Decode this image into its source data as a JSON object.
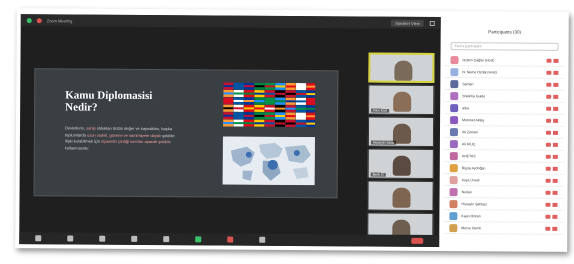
{
  "window": {
    "title": "Zoom Meeting",
    "view_button": "Speaker View"
  },
  "slide": {
    "title": "Kamu Diplomasisi Nedir?",
    "body_segments": [
      {
        "text": "Devletlerin, ",
        "hl": false
      },
      {
        "text": "sahip",
        "hl": true
      },
      {
        "text": " oldukları bütün değer ve kaynakları, başka toplumlarda ",
        "hl": false
      },
      {
        "text": "uzun vadeli, güvene ve samimiyete dayalı",
        "hl": true
      },
      {
        "text": " şekilde ilişki kurabilmek için ",
        "hl": false
      },
      {
        "text": "siyasetin çizdiği sınırları aşacak şekilde",
        "hl": true
      },
      {
        "text": " kullanmasıdır.",
        "hl": false
      }
    ]
  },
  "videos": [
    {
      "name": "",
      "active": true,
      "face": "#7a6a5a"
    },
    {
      "name": "Fikri Kurt",
      "active": false,
      "face": "#8a6e58"
    },
    {
      "name": "Hüseyin Sara",
      "active": false,
      "face": "#6b5a4c"
    },
    {
      "name": "Berk Ö",
      "active": false,
      "face": "#5a4a40"
    },
    {
      "name": "",
      "active": false,
      "face": "#7d6552"
    },
    {
      "name": "",
      "active": false,
      "face": "#6e5e50"
    }
  ],
  "participants_panel": {
    "title": "Participants (30)",
    "search_placeholder": "Find a participant",
    "items": [
      {
        "name": "Ozlem Çağlar (Host)",
        "color": "#e88a9a"
      },
      {
        "name": "N. Neme Ozdal (Host)",
        "color": "#9ab0e0"
      },
      {
        "name": "Saman",
        "color": "#5a6a9a"
      },
      {
        "name": "Sheikha Guide",
        "color": "#b070c0"
      },
      {
        "name": "aiba",
        "color": "#7060c0"
      },
      {
        "name": "Mehmet Aktaş",
        "color": "#8a5ac0"
      },
      {
        "name": "Ali Zaman",
        "color": "#6a7ab0"
      },
      {
        "name": "Ali KILIÇ",
        "color": "#9a6ac0"
      },
      {
        "name": "AHETAS",
        "color": "#c06aa0"
      },
      {
        "name": "Büşra Aydoğan",
        "color": "#e0a040"
      },
      {
        "name": "Asya Ünsal",
        "color": "#e0a0a0"
      },
      {
        "name": "Nurlan",
        "color": "#c070b0"
      },
      {
        "name": "Hüseyin Şahbaz",
        "color": "#d08060"
      },
      {
        "name": "Kaan Özkan",
        "color": "#60a0d0"
      },
      {
        "name": "Merve Demir",
        "color": "#d0a050"
      }
    ]
  }
}
